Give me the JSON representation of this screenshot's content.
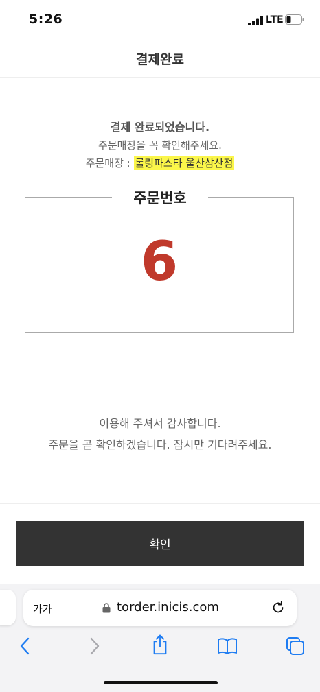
{
  "status_bar": {
    "time": "5:26",
    "network": "LTE"
  },
  "header": {
    "title": "결제완료"
  },
  "message": {
    "title": "결제 완료되었습니다.",
    "notice": "주문매장을 꼭 확인해주세요.",
    "store_label": "주문매장 : ",
    "store_name": "롤링파스타 울산삼산점"
  },
  "order": {
    "label": "주문번호",
    "number": "6"
  },
  "thanks": {
    "line1": "이용해 주셔서 감사합니다.",
    "line2": "주문을 곧 확인하겠습니다. 잠시만 기다려주세요."
  },
  "confirm_button": {
    "label": "확인"
  },
  "safari": {
    "aa_label": "가가",
    "url": "torder.inicis.com"
  },
  "colors": {
    "accent": "#c0392b",
    "highlight": "#fbf64a",
    "button_bg": "#333333"
  },
  "icons": [
    "signal-icon",
    "battery-icon",
    "lock-icon",
    "reload-icon",
    "back-icon",
    "forward-icon",
    "share-icon",
    "bookmarks-icon",
    "tabs-icon"
  ]
}
